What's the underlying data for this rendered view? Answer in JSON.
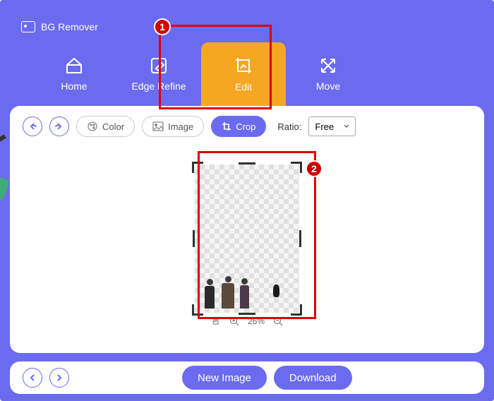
{
  "app": {
    "title": "BG Remover"
  },
  "nav": {
    "home": "Home",
    "edge_refine": "Edge Refine",
    "edit": "Edit",
    "move": "Move"
  },
  "toolbar": {
    "color": "Color",
    "image": "Image",
    "crop": "Crop",
    "ratio_label": "Ratio:",
    "ratio_value": "Free"
  },
  "zoom": {
    "value": "26%"
  },
  "footer": {
    "new_image": "New Image",
    "download": "Download"
  },
  "annotations": {
    "step1": "1",
    "step2": "2"
  }
}
